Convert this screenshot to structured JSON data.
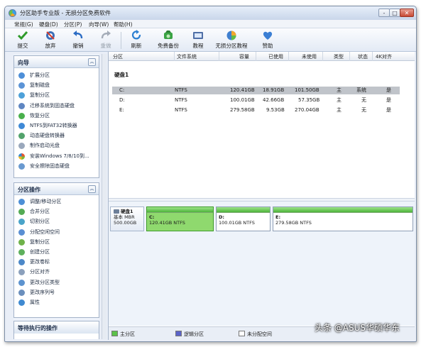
{
  "window": {
    "title": "分区助手专业版 - 无损分区免费软件",
    "controls": [
      "-",
      "□",
      "✕"
    ]
  },
  "menu": [
    "常规(G)",
    "硬盘(D)",
    "分区(P)",
    "向导(W)",
    "帮助(H)"
  ],
  "toolbar": [
    {
      "label": "提交",
      "icon": "check-icon",
      "enabled": true
    },
    {
      "label": "放弃",
      "icon": "discard-icon",
      "enabled": true
    },
    {
      "label": "撤销",
      "icon": "undo-icon",
      "enabled": true
    },
    {
      "label": "重做",
      "icon": "redo-icon",
      "enabled": false
    },
    {
      "label": "刷新",
      "icon": "refresh-icon",
      "enabled": true
    },
    {
      "label": "免费备份",
      "icon": "backup-icon",
      "enabled": true
    },
    {
      "label": "教程",
      "icon": "tutorial-icon",
      "enabled": true
    },
    {
      "label": "无损分区教程",
      "icon": "partition-tutorial-icon",
      "enabled": true
    },
    {
      "label": "赞助",
      "icon": "heart-icon",
      "enabled": true
    }
  ],
  "sidebar": {
    "wizard": {
      "title": "向导",
      "items": [
        "扩展分区",
        "复制磁盘",
        "复制分区",
        "迁移系统到固态硬盘",
        "恢复分区",
        "NTFS到FAT32转换器",
        "动态硬盘转换器",
        "制作启动光盘",
        "安装Windows 7/8/10到...",
        "安全擦除固态硬盘"
      ]
    },
    "ops": {
      "title": "分区操作",
      "items": [
        "调整/移动分区",
        "合并分区",
        "切割分区",
        "分配空闲空间",
        "复制分区",
        "创建分区",
        "更改卷标",
        "分区对齐",
        "更改分区类型",
        "更改序列号",
        "属性"
      ]
    },
    "pending": {
      "title": "等待执行的操作"
    }
  },
  "table": {
    "columns": [
      "分区",
      "文件系统",
      "容量",
      "已使用",
      "未使用",
      "类型",
      "状态",
      "4K对齐"
    ],
    "disk_label": "硬盘1",
    "rows": [
      {
        "name": "C:",
        "fs": "NTFS",
        "capacity": "120.41GB",
        "used": "18.91GB",
        "free": "101.50GB",
        "type": "主",
        "status": "系统",
        "aligned": "是"
      },
      {
        "name": "D:",
        "fs": "NTFS",
        "capacity": "100.01GB",
        "used": "42.66GB",
        "free": "57.35GB",
        "type": "主",
        "status": "无",
        "aligned": "是"
      },
      {
        "name": "E:",
        "fs": "NTFS",
        "capacity": "279.58GB",
        "used": "9.53GB",
        "free": "270.04GB",
        "type": "主",
        "status": "无",
        "aligned": "是"
      }
    ],
    "selected_row": 0
  },
  "diskmap": {
    "disk": {
      "name": "硬盘1",
      "type": "基本 MBR",
      "size": "500.00GB"
    },
    "partitions": [
      {
        "letter": "C:",
        "desc": "120.41GB NTFS",
        "selected": true
      },
      {
        "letter": "D:",
        "desc": "100.01GB NTFS",
        "selected": false
      },
      {
        "letter": "E:",
        "desc": "279.58GB NTFS",
        "selected": false
      }
    ]
  },
  "legend": [
    {
      "label": "主分区",
      "color": "#5cc24a"
    },
    {
      "label": "逻辑分区",
      "color": "#5a63c9"
    },
    {
      "label": "未分配空间",
      "color": "#ffffff"
    }
  ],
  "watermark": "头条 @ASUS华硕华东"
}
